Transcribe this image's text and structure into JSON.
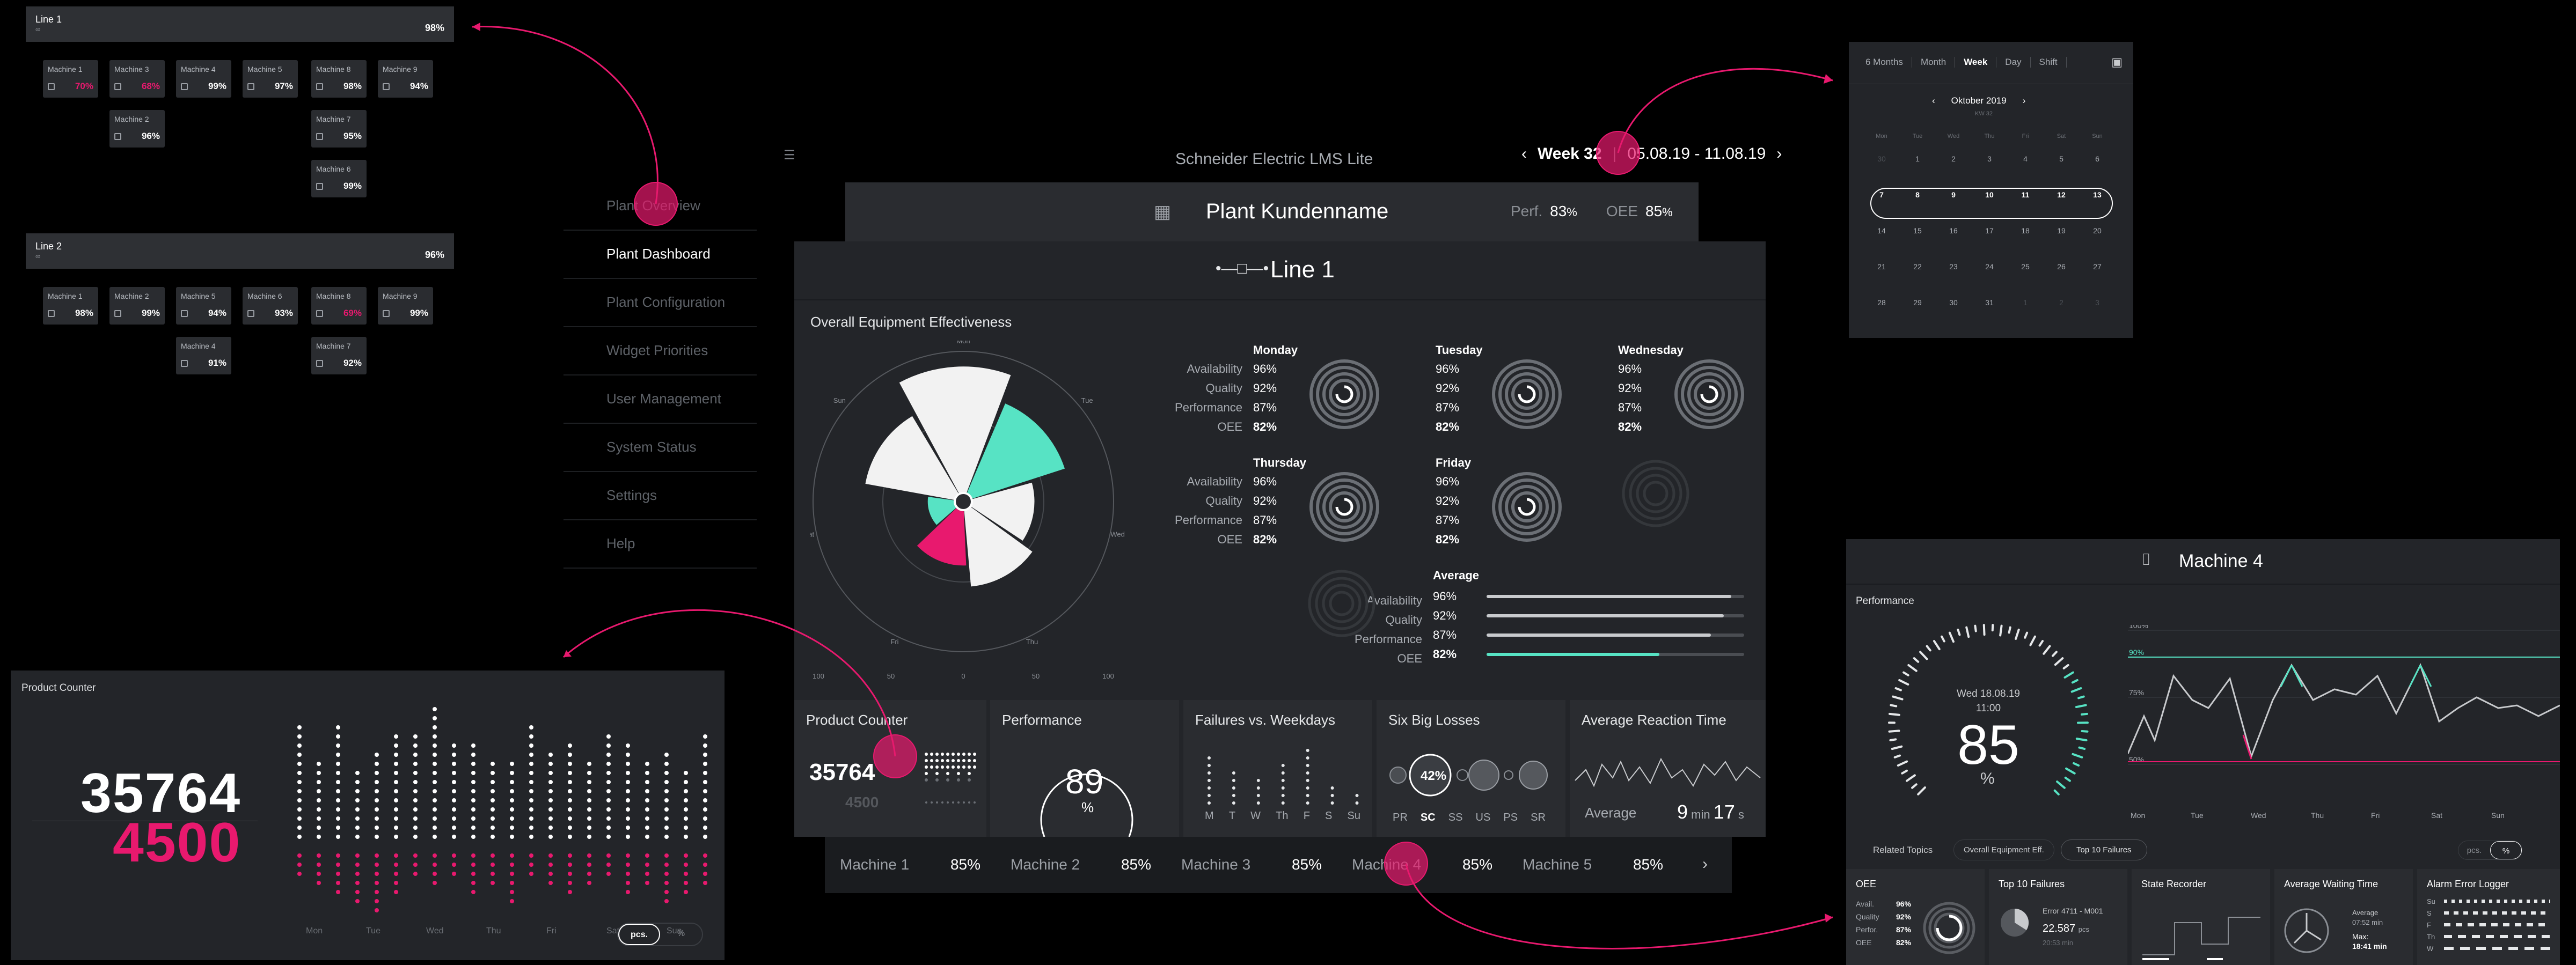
{
  "header": {
    "app_title": "Schneider Electric LMS Lite",
    "week_label": "Week 32",
    "week_range": "05.08.19 - 11.08.19",
    "plant_name": "Plant Kundenname",
    "perf_label": "Perf.",
    "perf_value": "83",
    "oee_label": "OEE",
    "oee_value": "85",
    "pct": "%"
  },
  "nav": {
    "items": [
      "Plant Overview",
      "Plant Dashboard",
      "Plant Configuration",
      "Widget Priorities",
      "User Management",
      "System Status",
      "Settings",
      "Help"
    ]
  },
  "overview": {
    "line1": {
      "label": "Line 1",
      "sub": "∞",
      "value": "98%"
    },
    "line2": {
      "label": "Line 2",
      "sub": "∞",
      "value": "96%"
    },
    "line1_machines": [
      {
        "name": "Machine 1",
        "value": "70%"
      },
      {
        "name": "Machine 3",
        "value": "68%"
      },
      {
        "name": "Machine 4",
        "value": "99%"
      },
      {
        "name": "Machine 5",
        "value": "97%"
      },
      {
        "name": "Machine 8",
        "value": "98%"
      },
      {
        "name": "Machine 9",
        "value": "94%"
      },
      {
        "name": "Machine 2",
        "value": "96%"
      },
      {
        "name": "Machine 7",
        "value": "95%"
      },
      {
        "name": "Machine 6",
        "value": "99%"
      }
    ],
    "line2_machines": [
      {
        "name": "Machine 1",
        "value": "98%"
      },
      {
        "name": "Machine 2",
        "value": "99%"
      },
      {
        "name": "Machine 5",
        "value": "94%"
      },
      {
        "name": "Machine 6",
        "value": "93%"
      },
      {
        "name": "Machine 8",
        "value": "69%"
      },
      {
        "name": "Machine 9",
        "value": "99%"
      },
      {
        "name": "Machine 4",
        "value": "91%"
      },
      {
        "name": "Machine 7",
        "value": "92%"
      }
    ]
  },
  "line_panel": {
    "title": "Line 1",
    "oee_title": "Overall Equipment Effectiveness",
    "metric_labels": [
      "Availability",
      "Quality",
      "Performance",
      "OEE"
    ],
    "days": [
      {
        "name": "Monday",
        "values": [
          "96%",
          "92%",
          "87%",
          "82%"
        ]
      },
      {
        "name": "Tuesday",
        "values": [
          "96%",
          "92%",
          "87%",
          "82%"
        ]
      },
      {
        "name": "Wednesday",
        "values": [
          "96%",
          "92%",
          "87%",
          "82%"
        ]
      },
      {
        "name": "Thursday",
        "values": [
          "96%",
          "92%",
          "87%",
          "82%"
        ]
      },
      {
        "name": "Friday",
        "values": [
          "96%",
          "92%",
          "87%",
          "82%"
        ]
      }
    ],
    "average": {
      "name": "Average",
      "values": [
        "96%",
        "92%",
        "87%",
        "82%"
      ],
      "bars": [
        0.95,
        0.92,
        0.87,
        0.67
      ]
    },
    "polar_days": [
      "Mon",
      "Tue",
      "Wed",
      "Thu",
      "Fri",
      "Sat",
      "Sun"
    ],
    "polar_values": [
      0.95,
      0.75,
      0.5,
      0.6,
      0.45,
      0.25,
      0.7
    ],
    "polar_scale": [
      "100",
      "50",
      "0",
      "50",
      "100"
    ]
  },
  "tiles": {
    "product_counter": {
      "title": "Product Counter",
      "value": "35764",
      "target": "4500"
    },
    "performance": {
      "title": "Performance",
      "value": "89",
      "unit": "%"
    },
    "failures": {
      "title": "Failures vs. Weekdays",
      "days": [
        "M",
        "T",
        "W",
        "Th",
        "F",
        "S",
        "Su"
      ],
      "values": [
        7,
        5,
        4,
        6,
        8,
        3,
        2
      ]
    },
    "six_big_losses": {
      "title": "Six Big Losses",
      "labels": [
        "PR",
        "SC",
        "SS",
        "US",
        "PS",
        "SR"
      ],
      "highlight": "42%"
    },
    "reaction": {
      "title": "Average Reaction Time",
      "label": "Average",
      "min": "9",
      "min_unit": "min",
      "sec": "17",
      "sec_unit": "s"
    }
  },
  "machine_tabs": [
    {
      "name": "Machine 1",
      "value": "85%"
    },
    {
      "name": "Machine 2",
      "value": "85%"
    },
    {
      "name": "Machine 3",
      "value": "85%"
    },
    {
      "name": "Machine 4",
      "value": "85%"
    },
    {
      "name": "Machine 5",
      "value": "85%"
    }
  ],
  "calendar": {
    "tabs": [
      "6 Months",
      "Month",
      "Week",
      "Day",
      "Shift"
    ],
    "month": "Oktober 2019",
    "kw": "KW 32",
    "weekdays": [
      "Mon",
      "Tue",
      "Wed",
      "Thu",
      "Fri",
      "Sat",
      "Sun"
    ],
    "rows": [
      [
        "30",
        "1",
        "2",
        "3",
        "4",
        "5",
        "6"
      ],
      [
        "7",
        "8",
        "9",
        "10",
        "11",
        "12",
        "13"
      ],
      [
        "14",
        "15",
        "16",
        "17",
        "18",
        "19",
        "20"
      ],
      [
        "21",
        "22",
        "23",
        "24",
        "25",
        "26",
        "27"
      ],
      [
        "28",
        "29",
        "30",
        "31",
        "1",
        "2",
        "3"
      ]
    ]
  },
  "product_counter_big": {
    "title": "Product Counter",
    "value": "35764",
    "target": "4500",
    "days": [
      "Mon",
      "Tue",
      "Wed",
      "Thu",
      "Fri",
      "Sat",
      "Sun"
    ],
    "toggle": [
      "pcs.",
      "%"
    ]
  },
  "machine4": {
    "title": "Machine 4",
    "perf_title": "Performance",
    "date": "Wed 18.08.19",
    "time": "11:00",
    "value": "85",
    "unit": "%",
    "y_ticks": [
      "100%",
      "90%",
      "75%",
      "50%"
    ],
    "x_ticks": [
      "Mon",
      "Tue",
      "Wed",
      "Thu",
      "Fri",
      "Sat",
      "Sun"
    ],
    "related_label": "Related Topics",
    "related": [
      "Overall Equipment Eff.",
      "Top 10 Failures"
    ],
    "toggle": [
      "pcs.",
      "%"
    ],
    "mini_tiles": {
      "oee": {
        "title": "OEE",
        "labels": [
          "Avail.",
          "Quality",
          "Perfor.",
          "OEE"
        ],
        "values": [
          "96%",
          "92%",
          "87%",
          "82%"
        ]
      },
      "failures": {
        "title": "Top 10 Failures",
        "error": "Error 4711 - M001",
        "count": "22.587",
        "count_unit": "pcs",
        "duration": "20:53 min"
      },
      "state": {
        "title": "State Recorder"
      },
      "waiting": {
        "title": "Average Waiting Time",
        "avg_label": "Average",
        "avg": "07:52 min",
        "max_label": "Max:",
        "max": "18:41 min"
      },
      "alarm": {
        "title": "Alarm Error Logger",
        "days": [
          "Su",
          "S",
          "F",
          "Th",
          "W"
        ]
      }
    }
  },
  "colors": {
    "accent_teal": "#57e3c4",
    "accent_pink": "#e8196e",
    "panel": "#232529"
  }
}
